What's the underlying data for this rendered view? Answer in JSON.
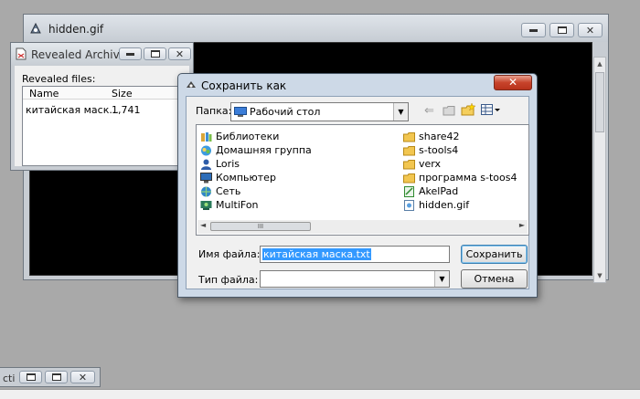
{
  "hidden_window": {
    "title": "hidden.gif"
  },
  "archive_window": {
    "title": "Revealed Archive",
    "files_label": "Revealed files:",
    "columns": [
      "Name",
      "Size"
    ],
    "rows": [
      {
        "name": "китайская маск...",
        "size": "1,741"
      }
    ]
  },
  "save_dialog": {
    "title": "Сохранить как",
    "close_label": "✕",
    "folder_label": "Папка:",
    "folder_value": "Рабочий стол",
    "files_left": [
      "Библиотеки",
      "Домашняя группа",
      "Loris",
      "Компьютер",
      "Сеть",
      "MultiFon"
    ],
    "files_right": [
      "share42",
      "s-tools4",
      "verx",
      "программа s-toos4",
      "AkelPad",
      "hidden.gif"
    ],
    "scroll_grip": "III",
    "filename_label": "Имя файла:",
    "filename_value": "китайская маска.txt",
    "filetype_label": "Тип файла:",
    "filetype_value": "",
    "save_label": "Сохранить",
    "cancel_label": "Отмена"
  },
  "minimized_window": {
    "title": "cti"
  },
  "colors": {
    "accent_selection": "#3399ff",
    "close_red": "#c7432b",
    "dialog_frame": "#cdd9e7"
  }
}
